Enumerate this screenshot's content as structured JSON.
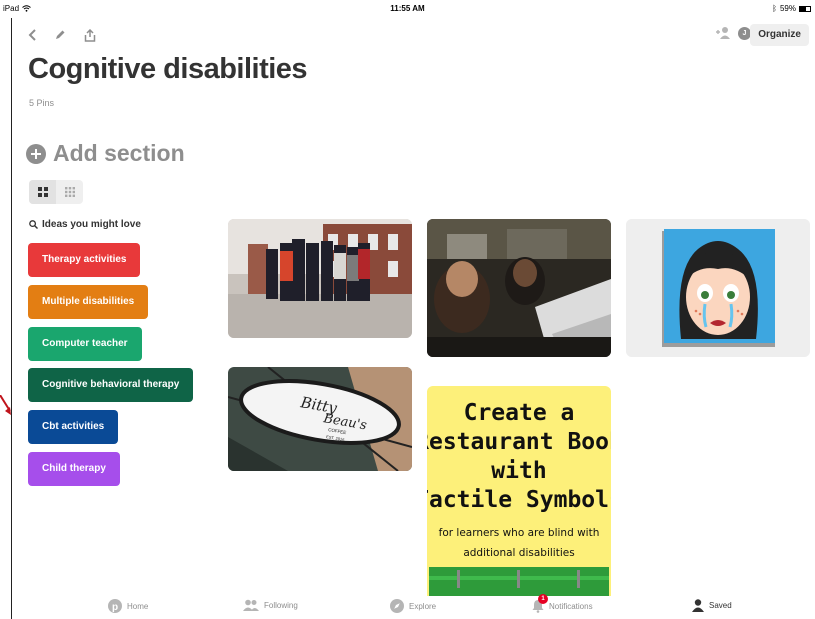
{
  "status_bar": {
    "device": "iPad",
    "time": "11:55 AM",
    "battery": "59%",
    "battery_level": 0.59
  },
  "toolbar": {
    "back_icon": "chevron-left-icon",
    "edit_icon": "pencil-icon",
    "share_icon": "share-icon",
    "add_collaborator_icon": "add-person-icon",
    "avatar_letter": "J",
    "organize_label": "Organize"
  },
  "board": {
    "title": "Cognitive disabilities",
    "pin_count": "5 Pins"
  },
  "add_section": {
    "label": "Add section"
  },
  "ideas": {
    "header": "Ideas you might love",
    "items": [
      {
        "label": "Therapy activities",
        "color": "#e8393a"
      },
      {
        "label": "Multiple disabilities",
        "color": "#e37e13"
      },
      {
        "label": "Computer teacher",
        "color": "#1aa66e"
      },
      {
        "label": "Cognitive behavioral therapy",
        "color": "#0f6447"
      },
      {
        "label": "Cbt activities",
        "color": "#0a4a96"
      },
      {
        "label": "Child therapy",
        "color": "#a64eeb"
      }
    ]
  },
  "pins": {
    "restaurant_book": {
      "line1": "Create a",
      "line2": "Restaurant Book",
      "line3": "with",
      "line4": "Tactile Symbols",
      "sub1": "for learners who are blind with",
      "sub2": "additional disabilities"
    },
    "cafe_sign": {
      "line1": "Bitty",
      "line2": "Beau's",
      "line3": "COFFEE",
      "line4": "EST. 2016"
    }
  },
  "bottom_nav": {
    "home": "Home",
    "following": "Following",
    "explore": "Explore",
    "notifications": "Notifications",
    "notification_count": "1",
    "saved": "Saved"
  }
}
